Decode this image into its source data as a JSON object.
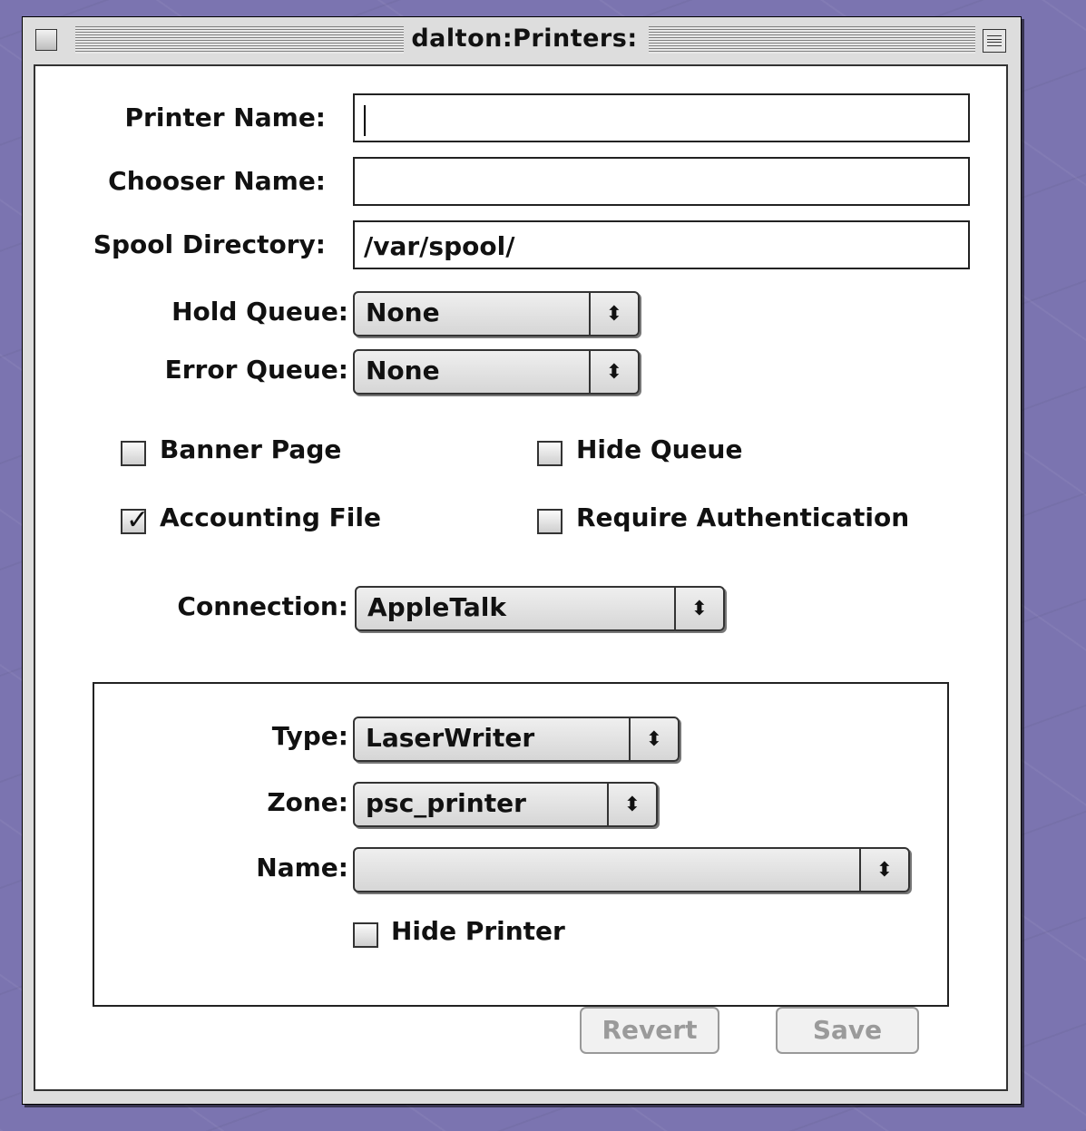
{
  "window": {
    "title": "dalton:Printers:"
  },
  "form": {
    "printer_name": {
      "label": "Printer Name:",
      "value": ""
    },
    "chooser_name": {
      "label": "Chooser Name:",
      "value": ""
    },
    "spool_directory": {
      "label": "Spool Directory:",
      "value": "/var/spool/"
    },
    "hold_queue": {
      "label": "Hold Queue:",
      "value": "None"
    },
    "error_queue": {
      "label": "Error Queue:",
      "value": "None"
    },
    "checkboxes": {
      "banner_page": {
        "label": "Banner Page",
        "checked": false
      },
      "hide_queue": {
        "label": "Hide Queue",
        "checked": false
      },
      "accounting_file": {
        "label": "Accounting File",
        "checked": true
      },
      "require_authentication": {
        "label": "Require Authentication",
        "checked": false
      }
    },
    "connection": {
      "label": "Connection:",
      "value": "AppleTalk"
    },
    "appletalk": {
      "type": {
        "label": "Type:",
        "value": "LaserWriter"
      },
      "zone": {
        "label": "Zone:",
        "value": "psc_printer"
      },
      "name": {
        "label": "Name:",
        "value": ""
      },
      "hide_printer": {
        "label": "Hide Printer",
        "checked": false
      }
    }
  },
  "buttons": {
    "revert": "Revert",
    "save": "Save"
  },
  "icons": {
    "popup_arrow": "up-down-arrows-icon",
    "check": "checkmark-icon"
  }
}
